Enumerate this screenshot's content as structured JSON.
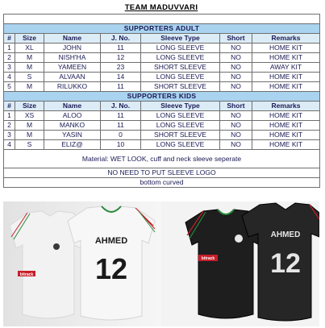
{
  "title": "TEAM MADUVVARI",
  "columns": [
    "#",
    "Size",
    "Name",
    "J. No.",
    "Sleeve Type",
    "Short",
    "Remarks"
  ],
  "adult": {
    "section_label": "SUPPORTERS ADULT",
    "rows": [
      {
        "num": "1",
        "size": "XL",
        "name": "JOHN",
        "jno": "11",
        "sleeve": "LONG SLEEVE",
        "short": "NO",
        "remarks": "HOME KIT"
      },
      {
        "num": "2",
        "size": "M",
        "name": "NISH'HA",
        "jno": "12",
        "sleeve": "LONG SLEEVE",
        "short": "NO",
        "remarks": "HOME KIT"
      },
      {
        "num": "3",
        "size": "M",
        "name": "YAMEEN",
        "jno": "23",
        "sleeve": "SHORT SLEEVE",
        "short": "NO",
        "remarks": "AWAY KIT"
      },
      {
        "num": "4",
        "size": "S",
        "name": "ALVAAN",
        "jno": "14",
        "sleeve": "LONG SLEEVE",
        "short": "NO",
        "remarks": "HOME KIT"
      },
      {
        "num": "5",
        "size": "M",
        "name": "RILUKKO",
        "jno": "11",
        "sleeve": "SHORT SLEEVE",
        "short": "NO",
        "remarks": "HOME KIT"
      }
    ]
  },
  "kids": {
    "section_label": "SUPPORTERS KIDS",
    "rows": [
      {
        "num": "1",
        "size": "XS",
        "name": "ALOO",
        "jno": "11",
        "sleeve": "LONG SLEEVE",
        "short": "NO",
        "remarks": "HOME KIT"
      },
      {
        "num": "2",
        "size": "M",
        "name": "MANKO",
        "jno": "11",
        "sleeve": "LONG SLEEVE",
        "short": "NO",
        "remarks": "HOME KIT"
      },
      {
        "num": "3",
        "size": "M",
        "name": "YASIN",
        "jno": "0",
        "sleeve": "SHORT SLEEVE",
        "short": "NO",
        "remarks": "HOME KIT"
      },
      {
        "num": "4",
        "size": "S",
        "name": "ELIZ@",
        "jno": "10",
        "sleeve": "LONG SLEEVE",
        "short": "NO",
        "remarks": "HOME KIT"
      }
    ]
  },
  "notes": {
    "material": "Material: WET LOOK, cuff and neck sleeve seperate",
    "logo": "NO NEED TO PUT SLEEVE LOGO",
    "bottom": "bottom curved"
  },
  "jersey": {
    "name": "AHMED",
    "number": "12",
    "sponsor": "bitrack",
    "colors": {
      "home_body": "#f4f4f4",
      "away_body": "#1e1e1e",
      "stripe_red": "#c81e2a",
      "stripe_green": "#2a8a3a",
      "section_fill": "#a9d3ef",
      "header_fill": "#dcecf7"
    }
  }
}
